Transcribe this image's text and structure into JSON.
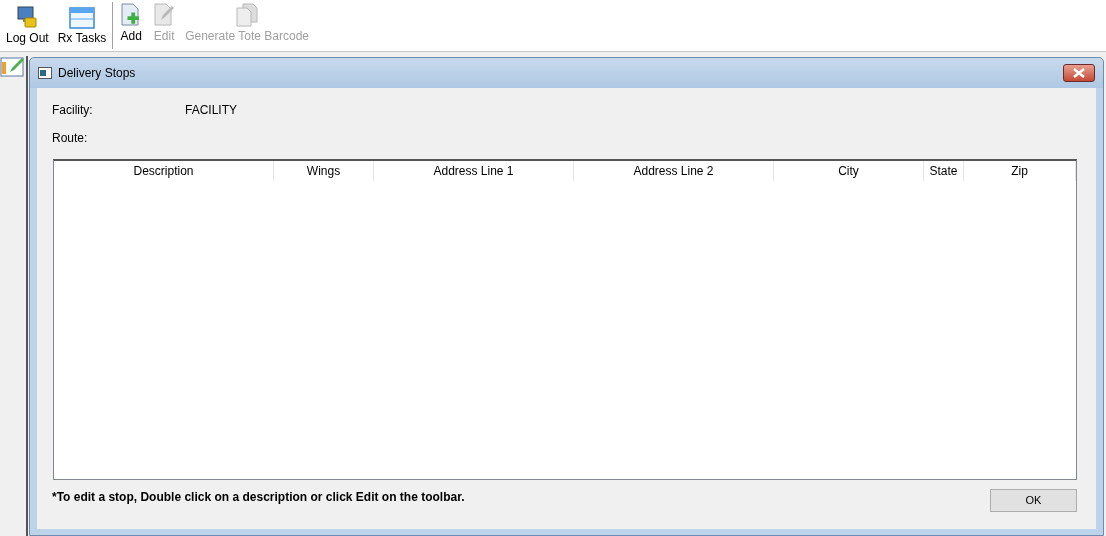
{
  "toolbar": {
    "groups": [
      [
        {
          "label": "Log Out",
          "kind": "logout",
          "disabled": false
        },
        {
          "label": "Rx Tasks",
          "kind": "window",
          "disabled": false
        }
      ],
      [
        {
          "label": "Add",
          "kind": "add",
          "disabled": false
        },
        {
          "label": "Edit",
          "kind": "edit",
          "disabled": true
        },
        {
          "label": "Generate Tote Barcode",
          "kind": "copy",
          "disabled": true
        }
      ]
    ]
  },
  "dialog": {
    "title": "Delivery Stops",
    "fields": [
      {
        "label": "Facility:",
        "value": "FACILITY"
      },
      {
        "label": "Route:"
      }
    ],
    "table": {
      "columns": [
        "Description",
        "Wings",
        "Address Line 1",
        "Address Line 2",
        "City",
        "State",
        "Zip"
      ]
    },
    "note": "*To edit a stop, Double click on a description or click Edit on the toolbar.",
    "buttons": [
      "OK"
    ]
  }
}
